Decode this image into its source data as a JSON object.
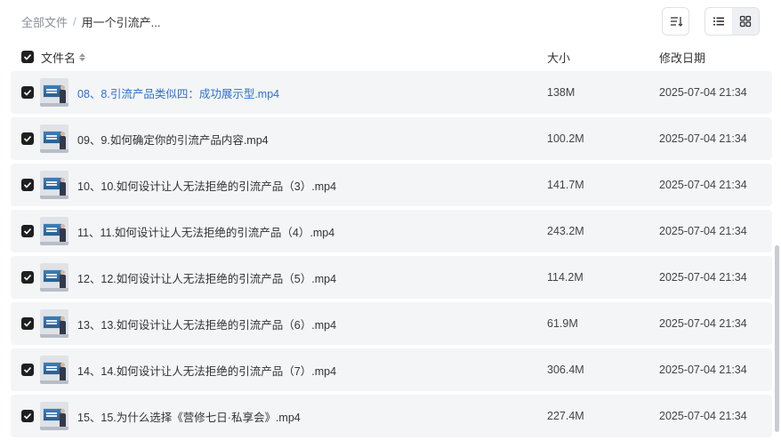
{
  "breadcrumb": {
    "root": "全部文件",
    "separator": "/",
    "current": "用一个引流产..."
  },
  "toolbar": {
    "sort_icon": "sort-lines-icon",
    "list_view_icon": "list-view-icon",
    "grid_view_icon": "grid-view-icon",
    "active_view": "list"
  },
  "table": {
    "header": {
      "name": "文件名",
      "size": "大小",
      "modified": "修改日期"
    },
    "all_selected": true,
    "rows": [
      {
        "name": "08、8.引流产品类似四：成功展示型.mp4",
        "size": "138M",
        "date": "2025-07-04 21:34",
        "checked": true,
        "highlight": true
      },
      {
        "name": "09、9.如何确定你的引流产品内容.mp4",
        "size": "100.2M",
        "date": "2025-07-04 21:34",
        "checked": true
      },
      {
        "name": "10、10.如何设计让人无法拒绝的引流产品（3）.mp4",
        "size": "141.7M",
        "date": "2025-07-04 21:34",
        "checked": true
      },
      {
        "name": "11、11.如何设计让人无法拒绝的引流产品（4）.mp4",
        "size": "243.2M",
        "date": "2025-07-04 21:34",
        "checked": true
      },
      {
        "name": "12、12.如何设计让人无法拒绝的引流产品（5）.mp4",
        "size": "114.2M",
        "date": "2025-07-04 21:34",
        "checked": true
      },
      {
        "name": "13、13.如何设计让人无法拒绝的引流产品（6）.mp4",
        "size": "61.9M",
        "date": "2025-07-04 21:34",
        "checked": true
      },
      {
        "name": "14、14.如何设计让人无法拒绝的引流产品（7）.mp4",
        "size": "306.4M",
        "date": "2025-07-04 21:34",
        "checked": true
      },
      {
        "name": "15、15.为什么选择《营修七日·私享会》.mp4",
        "size": "227.4M",
        "date": "2025-07-04 21:34",
        "checked": true
      }
    ]
  },
  "colors": {
    "accent_link": "#2f6fcf",
    "row_bg": "#f4f5f7",
    "checkbox": "#1f1f1f"
  }
}
